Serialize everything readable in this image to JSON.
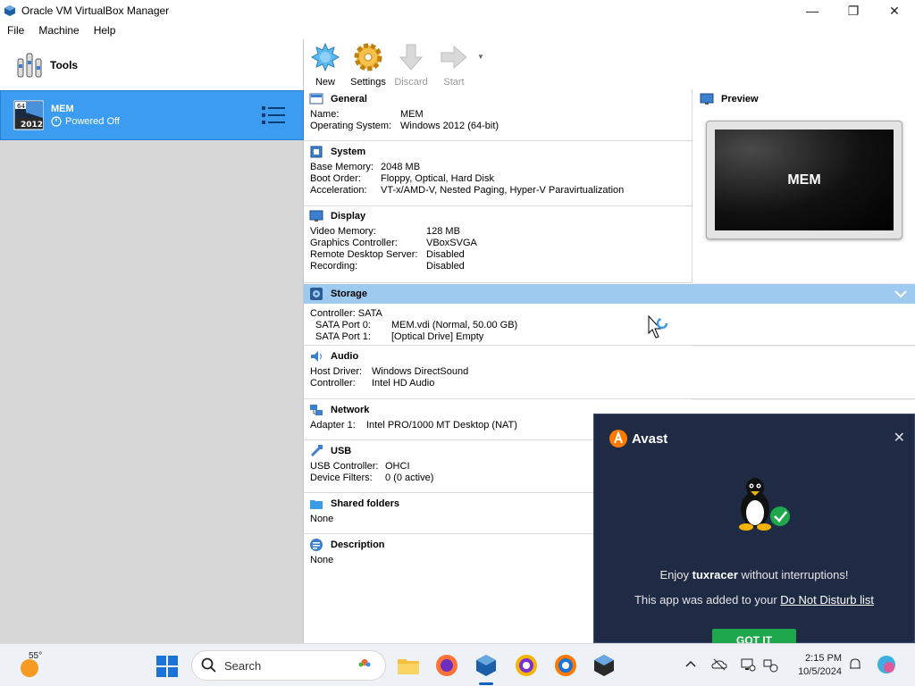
{
  "window": {
    "title": "Oracle VM VirtualBox Manager",
    "controls": {
      "minimize": "—",
      "maximize": "❐",
      "close": "✕"
    }
  },
  "menu": [
    "File",
    "Machine",
    "Help"
  ],
  "sidebar": {
    "tools_label": "Tools",
    "vm": {
      "name": "MEM",
      "state": "Powered Off",
      "os_badge_top": "64",
      "os_badge_year": "2012"
    }
  },
  "toolbar": {
    "new": "New",
    "settings": "Settings",
    "discard": "Discard",
    "start": "Start"
  },
  "details": {
    "general": {
      "title": "General",
      "rows": [
        {
          "k": "Name:",
          "v": "MEM"
        },
        {
          "k": "Operating System:",
          "v": "Windows 2012 (64-bit)"
        }
      ]
    },
    "system": {
      "title": "System",
      "rows": [
        {
          "k": "Base Memory:",
          "v": "2048 MB"
        },
        {
          "k": "Boot Order:",
          "v": "Floppy, Optical, Hard Disk"
        },
        {
          "k": "Acceleration:",
          "v": "VT-x/AMD-V, Nested Paging, Hyper-V Paravirtualization"
        }
      ]
    },
    "display": {
      "title": "Display",
      "rows": [
        {
          "k": "Video Memory:",
          "v": "128 MB"
        },
        {
          "k": "Graphics Controller:",
          "v": "VBoxSVGA"
        },
        {
          "k": "Remote Desktop Server:",
          "v": "Disabled"
        },
        {
          "k": "Recording:",
          "v": "Disabled"
        }
      ]
    },
    "storage": {
      "title": "Storage",
      "controller": "Controller: SATA",
      "rows": [
        {
          "k": "SATA Port 0:",
          "v": "MEM.vdi (Normal, 50.00 GB)"
        },
        {
          "k": "SATA Port 1:",
          "v": "[Optical Drive] Empty"
        }
      ]
    },
    "audio": {
      "title": "Audio",
      "rows": [
        {
          "k": "Host Driver:",
          "v": "Windows DirectSound"
        },
        {
          "k": "Controller:",
          "v": "Intel HD Audio"
        }
      ]
    },
    "network": {
      "title": "Network",
      "rows": [
        {
          "k": "Adapter 1:",
          "v": "Intel PRO/1000 MT Desktop (NAT)"
        }
      ]
    },
    "usb": {
      "title": "USB",
      "rows": [
        {
          "k": "USB Controller:",
          "v": "OHCI"
        },
        {
          "k": "Device Filters:",
          "v": "0 (0 active)"
        }
      ]
    },
    "shared_folders": {
      "title": "Shared folders",
      "value": "None"
    },
    "description": {
      "title": "Description",
      "value": "None"
    }
  },
  "preview": {
    "title": "Preview",
    "screen_label": "MEM"
  },
  "avast": {
    "brand": "Avast",
    "msg_prefix": "Enjoy ",
    "msg_app": "tuxracer",
    "msg_suffix": " without interruptions!",
    "msg2_prefix": "This app was added to your ",
    "msg2_link": "Do Not Disturb list",
    "button": "GOT IT",
    "close": "✕"
  },
  "taskbar": {
    "weather_temp": "55°",
    "search_placeholder": "Search",
    "clock_time": "2:15 PM",
    "clock_date": "10/5/2024"
  }
}
